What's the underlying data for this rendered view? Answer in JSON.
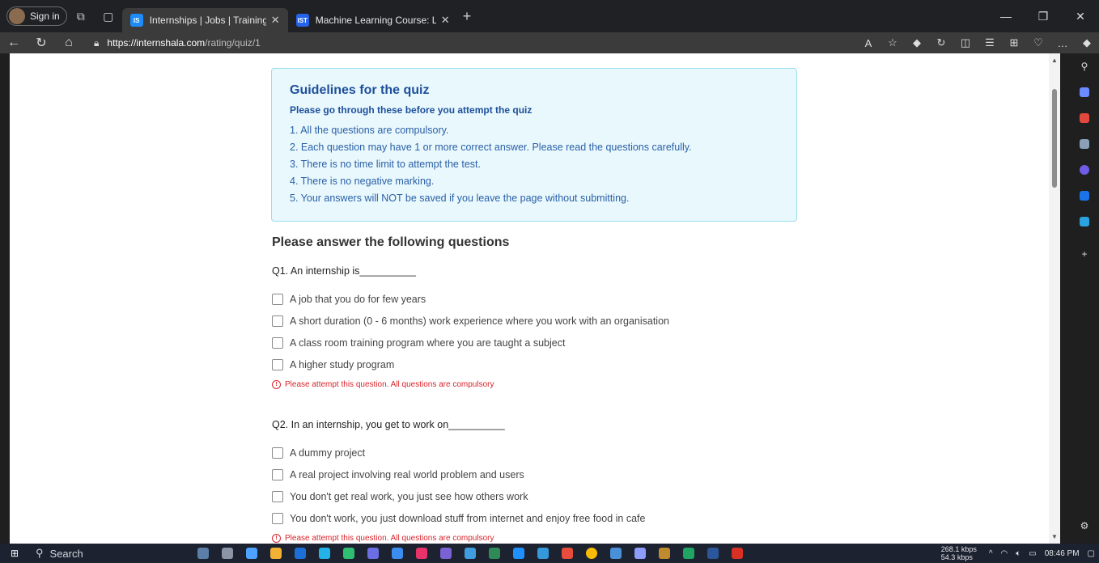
{
  "browser": {
    "signin_label": "Sign in",
    "tabs": [
      {
        "favicon": "IS",
        "title": "Internships | Jobs | Trainings & P"
      },
      {
        "favicon": "IST",
        "title": "Machine Learning Course: Learn"
      }
    ],
    "url_domain": "https://internshala.com",
    "url_path": "/rating/quiz/1"
  },
  "guidelines": {
    "title": "Guidelines for the quiz",
    "subtitle": "Please go through these before you attempt the quiz",
    "items": [
      "1. All the questions are compulsory.",
      "2. Each question may have 1 or more correct answer. Please read the questions carefully.",
      "3. There is no time limit to attempt the test.",
      "4. There is no negative marking.",
      "5. Your answers will NOT be saved if you leave the page without submitting."
    ]
  },
  "quiz": {
    "heading": "Please answer the following questions",
    "questions": [
      {
        "text": "Q1. An internship is__________",
        "options": [
          "A job that you do for few years",
          "A short duration (0 - 6 months) work experience where you work with an organisation",
          "A class room training program where you are taught a subject",
          "A higher study program"
        ],
        "error": "Please attempt this question. All questions are compulsory"
      },
      {
        "text": "Q2. In an internship, you get to work on__________",
        "options": [
          "A dummy project",
          "A real project involving real world problem and users",
          "You don't get real work, you just see how others work",
          "You don't work, you just download stuff from internet and enjoy free food in cafe"
        ],
        "error": "Please attempt this question. All questions are compulsory"
      }
    ]
  },
  "taskbar": {
    "search_label": "Search",
    "net_down": "268.1 kbps",
    "net_up": "54.3 kbps",
    "time": "08:46 PM"
  },
  "colors": {
    "guideline_bg": "#e8f8fc",
    "guideline_border": "#9adff0",
    "guideline_text": "#1e4f9c",
    "error": "#d9242b"
  }
}
